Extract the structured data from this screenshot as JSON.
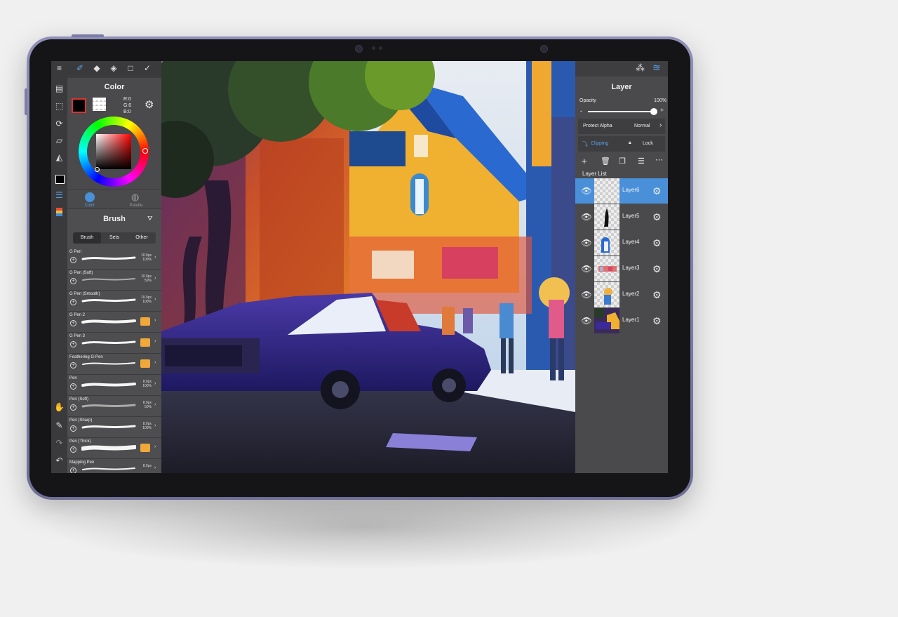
{
  "color_panel": {
    "title": "Color",
    "rgb_r": "R:0",
    "rgb_g": "G:0",
    "rgb_b": "B:0",
    "tab_color": "Color",
    "tab_palette": "Palette",
    "foreground_color": "#000000"
  },
  "brush_panel": {
    "title": "Brush",
    "tabs": [
      "Brush",
      "Sets",
      "Other"
    ],
    "items": [
      {
        "name": "G Pen",
        "size": "10.0px",
        "opacity": "100%"
      },
      {
        "name": "G Pen (Soft)",
        "size": "10.0px",
        "opacity": "50%"
      },
      {
        "name": "G Pen (Smooth)",
        "size": "10.0px",
        "opacity": "100%"
      },
      {
        "name": "G Pen 2",
        "size": "",
        "opacity": ""
      },
      {
        "name": "G Pen 3",
        "size": "",
        "opacity": ""
      },
      {
        "name": "Feathering G-Pen",
        "size": "",
        "opacity": ""
      },
      {
        "name": "Pen",
        "size": "8.0px",
        "opacity": "100%"
      },
      {
        "name": "Pen (Soft)",
        "size": "8.0px",
        "opacity": "50%"
      },
      {
        "name": "Pen (Sharp)",
        "size": "8.0px",
        "opacity": "100%"
      },
      {
        "name": "Pen (Thick)",
        "size": "",
        "opacity": ""
      },
      {
        "name": "Mapping Pen",
        "size": "8.0px",
        "opacity": ""
      }
    ]
  },
  "layer_panel": {
    "title": "Layer",
    "opacity_label": "Opacity",
    "opacity_value": "100%",
    "opacity_fraction": 1.0,
    "minus": "-",
    "plus": "+",
    "protect_alpha": "Protect Alpha",
    "blend_mode": "Normal",
    "clipping": "Clipping",
    "lock": "Lock",
    "list_label": "Layer List",
    "layers": [
      {
        "name": "Layer6",
        "selected": true
      },
      {
        "name": "Layer5",
        "selected": false
      },
      {
        "name": "Layer4",
        "selected": false
      },
      {
        "name": "Layer3",
        "selected": false
      },
      {
        "name": "Layer2",
        "selected": false
      },
      {
        "name": "Layer1",
        "selected": false
      }
    ]
  },
  "colors": {
    "accent": "#4a90d9",
    "panel": "#4a4a4c",
    "tablet_frame": "#7c7ca6"
  }
}
